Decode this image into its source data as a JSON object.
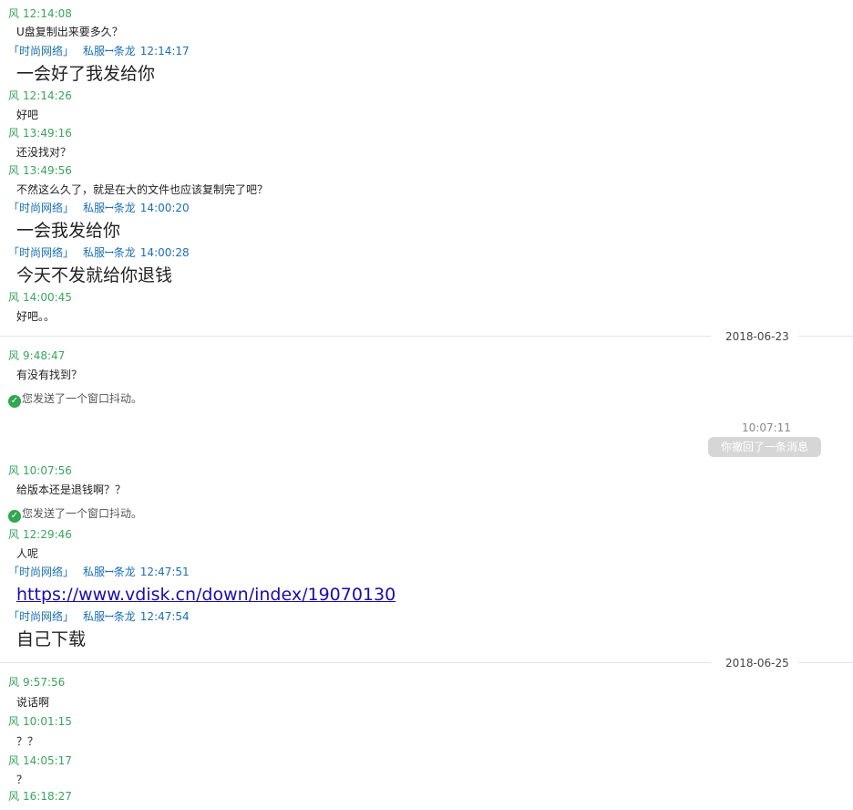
{
  "labels": {
    "me_name": "风",
    "peer_group": "「时尚网络」",
    "peer_name": "私服ꟷ条龙",
    "shake_text": "您发送了一个窗口抖动。",
    "recall_text": "你撤回了一条消息"
  },
  "colors": {
    "me": "#3aa55c",
    "peer": "#1a6fb3",
    "link": "#1a0dab",
    "check": "#2fa84f"
  },
  "messages": [
    {
      "time": "12:14:08",
      "text": "U盘复制出来要多久？"
    },
    {
      "time": "12:14:17",
      "text": "一会好了我发给你"
    },
    {
      "time": "12:14:26",
      "text": "好吧"
    },
    {
      "time": "13:49:16",
      "text": "还没找对？"
    },
    {
      "time": "13:49:56",
      "text": "不然这么久了，就是在大的文件也应该复制完了吧？"
    },
    {
      "time": "14:00:20",
      "text": "一会我发给你"
    },
    {
      "time": "14:00:28",
      "text": "今天不发就给你退钱"
    },
    {
      "time": "14:00:45",
      "text": "好吧。。"
    },
    {
      "time": "9:48:47",
      "text": "有没有找到？"
    },
    {
      "time": "10:07:11"
    },
    {
      "time": "10:07:56",
      "text": "给版本还是退钱啊？？"
    },
    {
      "time": "12:29:46",
      "text": "人呢"
    },
    {
      "time": "12:47:51",
      "text": "https://www.vdisk.cn/down/index/19070130"
    },
    {
      "time": "12:47:54",
      "text": "自己下载"
    },
    {
      "time": "9:57:56",
      "text": "说话啊"
    },
    {
      "time": "10:01:15",
      "text": "？？"
    },
    {
      "time": "14:05:17",
      "text": "？"
    },
    {
      "time": "16:18:27"
    }
  ],
  "dates": [
    "2018-06-23",
    "2018-06-25"
  ]
}
